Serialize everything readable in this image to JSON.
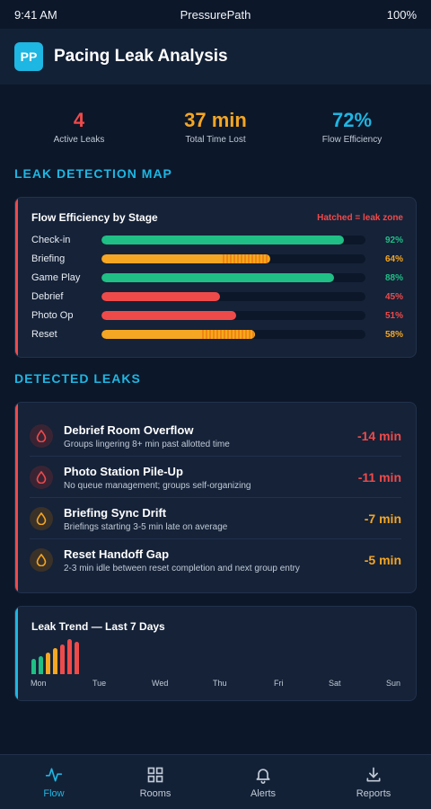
{
  "status_bar": {
    "time": "9:41 AM",
    "app_name": "PressurePath",
    "battery": "100%"
  },
  "header": {
    "logo_text": "PP",
    "title": "Pacing Leak Analysis"
  },
  "stats": [
    {
      "value": "4",
      "label": "Active Leaks",
      "color": "#ef4a4a"
    },
    {
      "value": "37 min",
      "label": "Total Time Lost",
      "color": "#f5a623"
    },
    {
      "value": "72%",
      "label": "Flow Efficiency",
      "color": "#1eb6e2"
    }
  ],
  "leak_map": {
    "section_title": "LEAK DETECTION MAP",
    "card_title": "Flow Efficiency by Stage",
    "note": "Hatched = leak zone",
    "stages": [
      {
        "name": "Check-in",
        "percent": 92,
        "percent_label": "92%",
        "color": "#1fbf85",
        "hatch_percent": 0
      },
      {
        "name": "Briefing",
        "percent": 64,
        "percent_label": "64%",
        "color": "#f5a623",
        "hatch_percent": 18
      },
      {
        "name": "Game Play",
        "percent": 88,
        "percent_label": "88%",
        "color": "#1fbf85",
        "hatch_percent": 0
      },
      {
        "name": "Debrief",
        "percent": 45,
        "percent_label": "45%",
        "color": "#ef4a4a",
        "hatch_percent": 0
      },
      {
        "name": "Photo Op",
        "percent": 51,
        "percent_label": "51%",
        "color": "#ef4a4a",
        "hatch_percent": 0
      },
      {
        "name": "Reset",
        "percent": 58,
        "percent_label": "58%",
        "color": "#f5a623",
        "hatch_percent": 20
      }
    ]
  },
  "leaks": {
    "section_title": "DETECTED LEAKS",
    "items": [
      {
        "title": "Debrief Room Overflow",
        "subtitle": "Groups lingering 8+ min past allotted time",
        "value": "-14 min",
        "color": "#ef4a4a",
        "icon": "droplet-icon"
      },
      {
        "title": "Photo Station Pile-Up",
        "subtitle": "No queue management; groups self-organizing",
        "value": "-11 min",
        "color": "#ef4a4a",
        "icon": "droplet-icon"
      },
      {
        "title": "Briefing Sync Drift",
        "subtitle": "Briefings starting 3-5 min late on average",
        "value": "-7 min",
        "color": "#f5a623",
        "icon": "droplet-icon"
      },
      {
        "title": "Reset Handoff Gap",
        "subtitle": "2-3 min idle between reset completion and next group entry",
        "value": "-5 min",
        "color": "#f5a623",
        "icon": "droplet-icon"
      }
    ]
  },
  "trend": {
    "title": "Leak Trend — Last 7 Days",
    "days": [
      "Mon",
      "Tue",
      "Wed",
      "Thu",
      "Fri",
      "Sat",
      "Sun"
    ],
    "bar_values": [
      17,
      20,
      24,
      29,
      33,
      39,
      36
    ],
    "bar_colors": [
      "#1fbf85",
      "#1fbf85",
      "#f5a623",
      "#f5a623",
      "#ef4a4a",
      "#ef4a4a",
      "#ef4a4a"
    ]
  },
  "nav": {
    "active_color": "#1eb6e2",
    "inactive_color": "#c1cad6",
    "items": [
      {
        "label": "Flow",
        "icon": "activity-icon",
        "active": true
      },
      {
        "label": "Rooms",
        "icon": "grid-icon",
        "active": false
      },
      {
        "label": "Alerts",
        "icon": "bell-icon",
        "active": false
      },
      {
        "label": "Reports",
        "icon": "download-icon",
        "active": false
      }
    ]
  }
}
